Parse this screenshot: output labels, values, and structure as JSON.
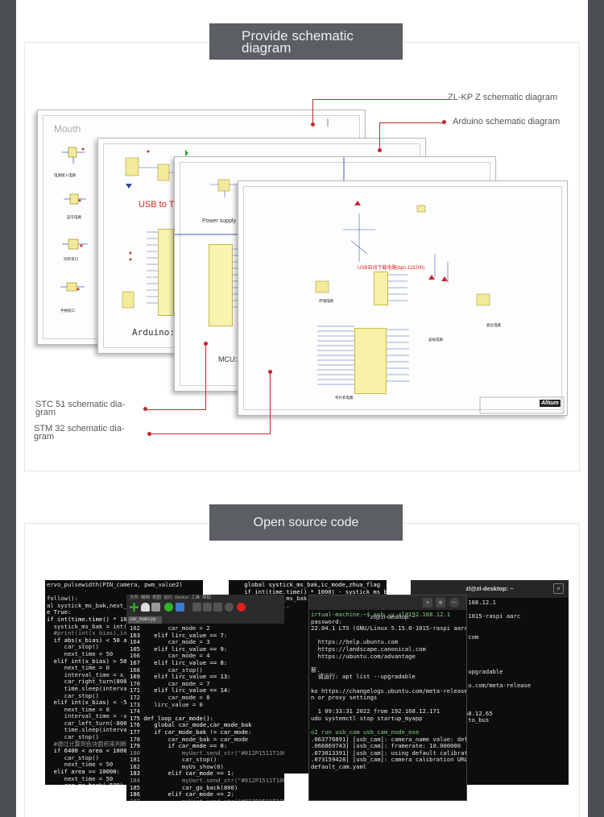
{
  "section1": {
    "title": "Provide schematic diagram",
    "callouts": {
      "zlkpz": "ZL-KP Z schematic diagram",
      "arduino": "Arduino schematic diagram",
      "stc51": "STC 51 schematic dia-gram",
      "stm32": "STM 32 schematic dia-gram"
    },
    "sheet_labels": {
      "mouth": "Mouth",
      "usb": "USB to T",
      "arduino": "Arduino:",
      "power": "Power supply",
      "mcu": "MCU:S",
      "usb_cn": "USB自动下载电路(bps:115200)",
      "altium": "Altium"
    }
  },
  "section2": {
    "title": "Open source code",
    "ide_tab": "car_main.py",
    "ide_menu": "文件  编辑  视图  运行  Device  工具  帮助",
    "ssh_title": "zl@zl-desktop: ~",
    "ssh_title2": "zl@zl-desktop: ~",
    "code_left": [
      "ervo_pulsewidth(PIN_camera, pwm_value2)",
      "",
      "follow():",
      "al systick_ms_bak,next_tim",
      "e True:",
      "if int(time.time() * 1000)",
      "  systick_ms_bak = int((",
      "  #print(int(x_bias),int",
      "  if abs(x_bias) < 50 and",
      "     car_stop()",
      "     next_time = 50",
      "  elif int(x_bias) > 50:",
      "     next_time = 0",
      "     interval_time = x_b",
      "     car_right_turn(800",
      "     time.sleep(interval",
      "     car_stop()",
      "  elif int(x_bias) < -50",
      "     next_time = 0",
      "     interval_time = -x_",
      "     car_left_turn(-800",
      "     time.sleep(interval",
      "     car_stop()",
      "  #通过计算到色块面积来判断",
      "  if 6400 < area < 10000",
      "     car_stop()",
      "     next_time = 50",
      "  elif area >= 10000:",
      "     next_time = 50",
      "     car_go_back(-500)"
    ],
    "code_mid": [
      "162        car_mode = 2",
      "163    elif lirc_value == 7:",
      "164        car_mode = 3",
      "165    elif lirc_value == 9:",
      "166        car_mode = 4",
      "167    elif lirc_value == 8:",
      "168        car_stop()",
      "169    elif lirc_value == 13:",
      "170        car_mode = 7",
      "171    elif lirc_value == 14:",
      "172        car_mode = 8",
      "173    lirc_value = 0",
      "174",
      "175 def loop_car_mode():",
      "176    global car_mode,car_mode_bak",
      "177    if car_mode_bak != car_mode:",
      "178        car_mode_bak = car_mode",
      "179        if car_mode == 0:",
      "180            myUart.send_str(\"#012P1511T100",
      "181            car_stop()",
      "182            myUs_show(0)",
      "183        elif car_mode == 1:",
      "184            myUart.send_str(\"#012P1511T100",
      "185            car_go_back(800)",
      "186        elif car_mode == 2:",
      "187            myUart.send_str(\"#012P1511T100",
      "188            car_go_back(-800)",
      "189        elif car_mode == 3:",
      "190            myUart.send_str(\"#012P1513T100"
    ],
    "code_back": [
      "    global systick_ms_bak,ic_mode,zhua_flag",
      "    if int(time.time() * 1000) - systick_ms_bak > 16 and",
      "        systick_ms_bak = int(time.time() * 1000))",
      "    ioctl(12) ...",
      "    ...",
      "PIO.input",
      "time.sleep",
      "if GPIO.in",
      "  y_value",
      "  kinemati",
      "",
      "PIO.input",
      "ime.sleep",
      "f GPIO.in",
      "  myUart",
      "  beep",
      "  kinemati"
    ],
    "ssh_mid": [
      "irtual-machine:~$ ssh -y zl@192.168.12.1",
      "password:",
      "22.04.1 LTS (GNU/Linux 5.15.0-1015-raspi aarch64)",
      "",
      "  https://help.ubuntu.com",
      "  https://landscape.canonical.com",
      "  https://ubuntu.com/advantage",
      "",
      "新.",
      "  请运行: apt list --upgradable",
      "",
      "ko https://changelogs.ubuntu.com/meta-release-lts. Check",
      "n or proxy settings",
      "",
      "  1 09:33:31 2022 from 192.168.12.171",
      "udo systemctl stop startup_myapp",
      "",
      "o2 run usb_cam usb_cam_node_exe",
      ".063776891] [usb_cam]: camera_name value: default_cam",
      ".066869743] [usb_cam]: framerate: 10.000000",
      ".073013391] [usb_cam]: using default calibration URL",
      ".073159428] [usb_cam]: camera calibration URL: file:///",
      "default_cam.yaml"
    ],
    "ssh_right": [
      "$ ssh -Y zl@192.168.12.1",
      "",
      "NU/Linux 5.15.0-1015-raspi aarc",
      "",
      "buntu.com",
      "scape.canonical.com",
      "u.com/advantage",
      "",
      "",
      "lately.",
      "run: apt list --upgradable",
      "",
      "changelogs.ubuntu.com/meta-release",
      "ttings",
      "",
      "",
      "2022 from 192.168.12.65",
      "control cmd_vel_to_bus"
    ]
  }
}
